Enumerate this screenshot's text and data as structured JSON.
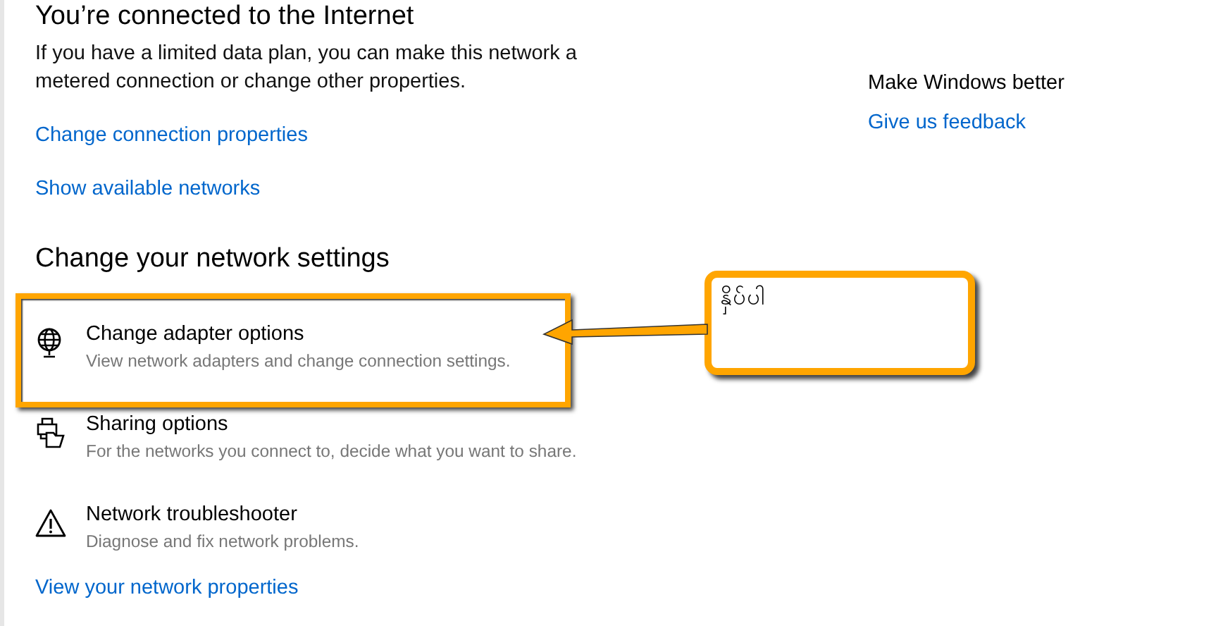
{
  "status": {
    "title": "You’re connected to the Internet",
    "description": "If you have a limited data plan, you can make this network a metered connection or change other properties.",
    "links": [
      "Change connection properties",
      "Show available networks"
    ]
  },
  "settings": {
    "heading": "Change your network settings",
    "items": [
      {
        "kind": "adapter",
        "title": "Change adapter options",
        "description": "View network adapters and change connection settings.",
        "highlighted": true
      },
      {
        "kind": "sharing",
        "title": "Sharing options",
        "description": "For the networks you connect to, decide what you want to share.",
        "highlighted": false
      },
      {
        "kind": "troubleshoot",
        "title": "Network troubleshooter",
        "description": "Diagnose and fix network problems.",
        "highlighted": false
      }
    ],
    "link": "View your network properties"
  },
  "aside": {
    "heading": "Make Windows better",
    "link": "Give us feedback"
  },
  "callout": {
    "text": "နှိပ်ပါ"
  }
}
